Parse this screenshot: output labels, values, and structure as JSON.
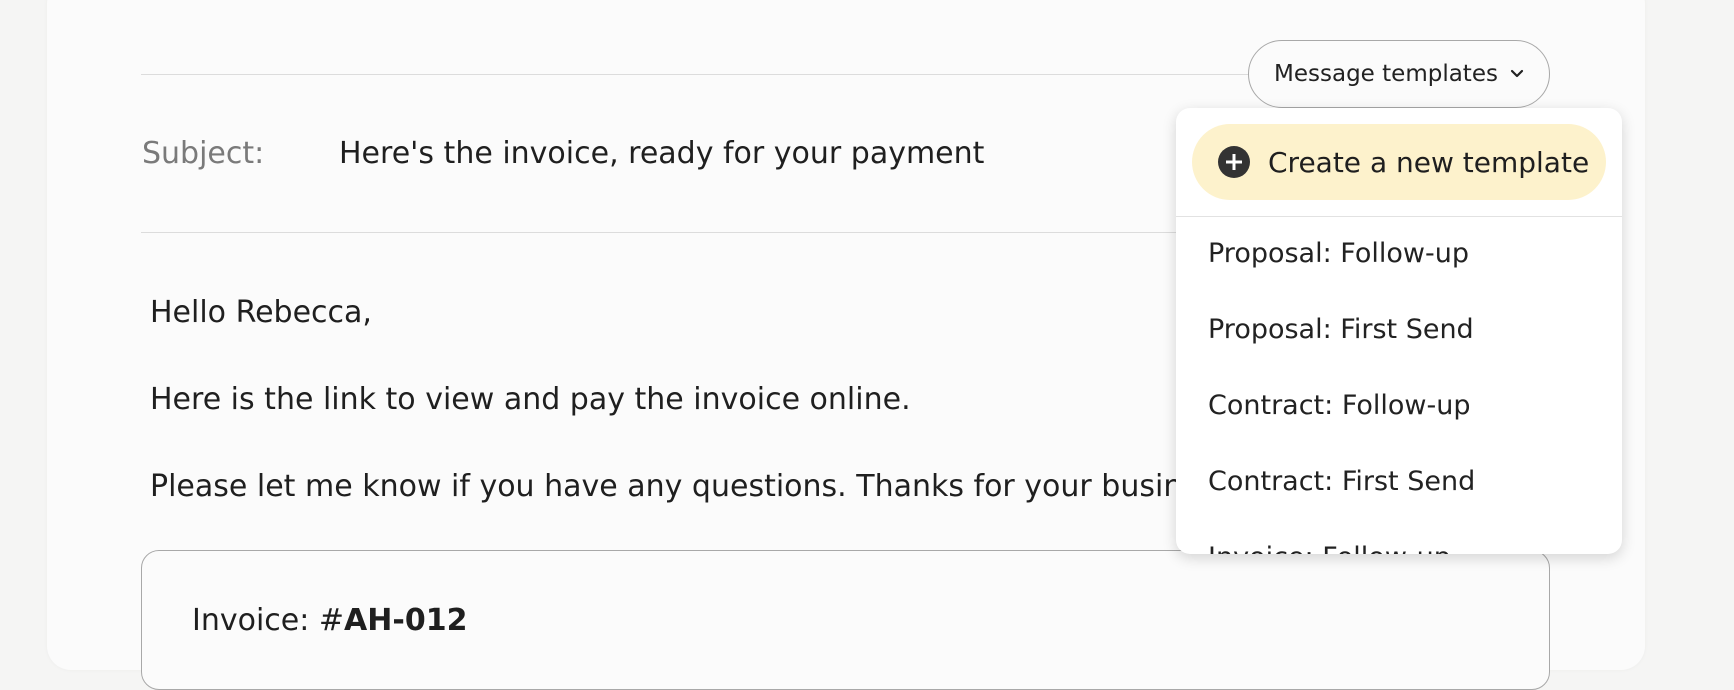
{
  "toolbar": {
    "templates_button_label": "Message templates",
    "templates_button_icon": "chevron-down-icon"
  },
  "subject": {
    "label": "Subject:",
    "value": "Here's the invoice, ready for your payment"
  },
  "message": {
    "lines": [
      "Hello Rebecca,",
      "Here is the link to view and pay the invoice online.",
      "Please let me know if you have any questions. Thanks for your business!"
    ]
  },
  "invoice": {
    "label": "Invoice: #",
    "number": "AH-012"
  },
  "templates_menu": {
    "create_label": "Create a new template",
    "create_icon": "plus-circle-icon",
    "create_bg_color": "#fdf2cc",
    "items": [
      "Proposal: Follow-up",
      "Proposal: First Send",
      "Contract: Follow-up",
      "Contract: First Send",
      "Invoice: Follow-up"
    ]
  }
}
